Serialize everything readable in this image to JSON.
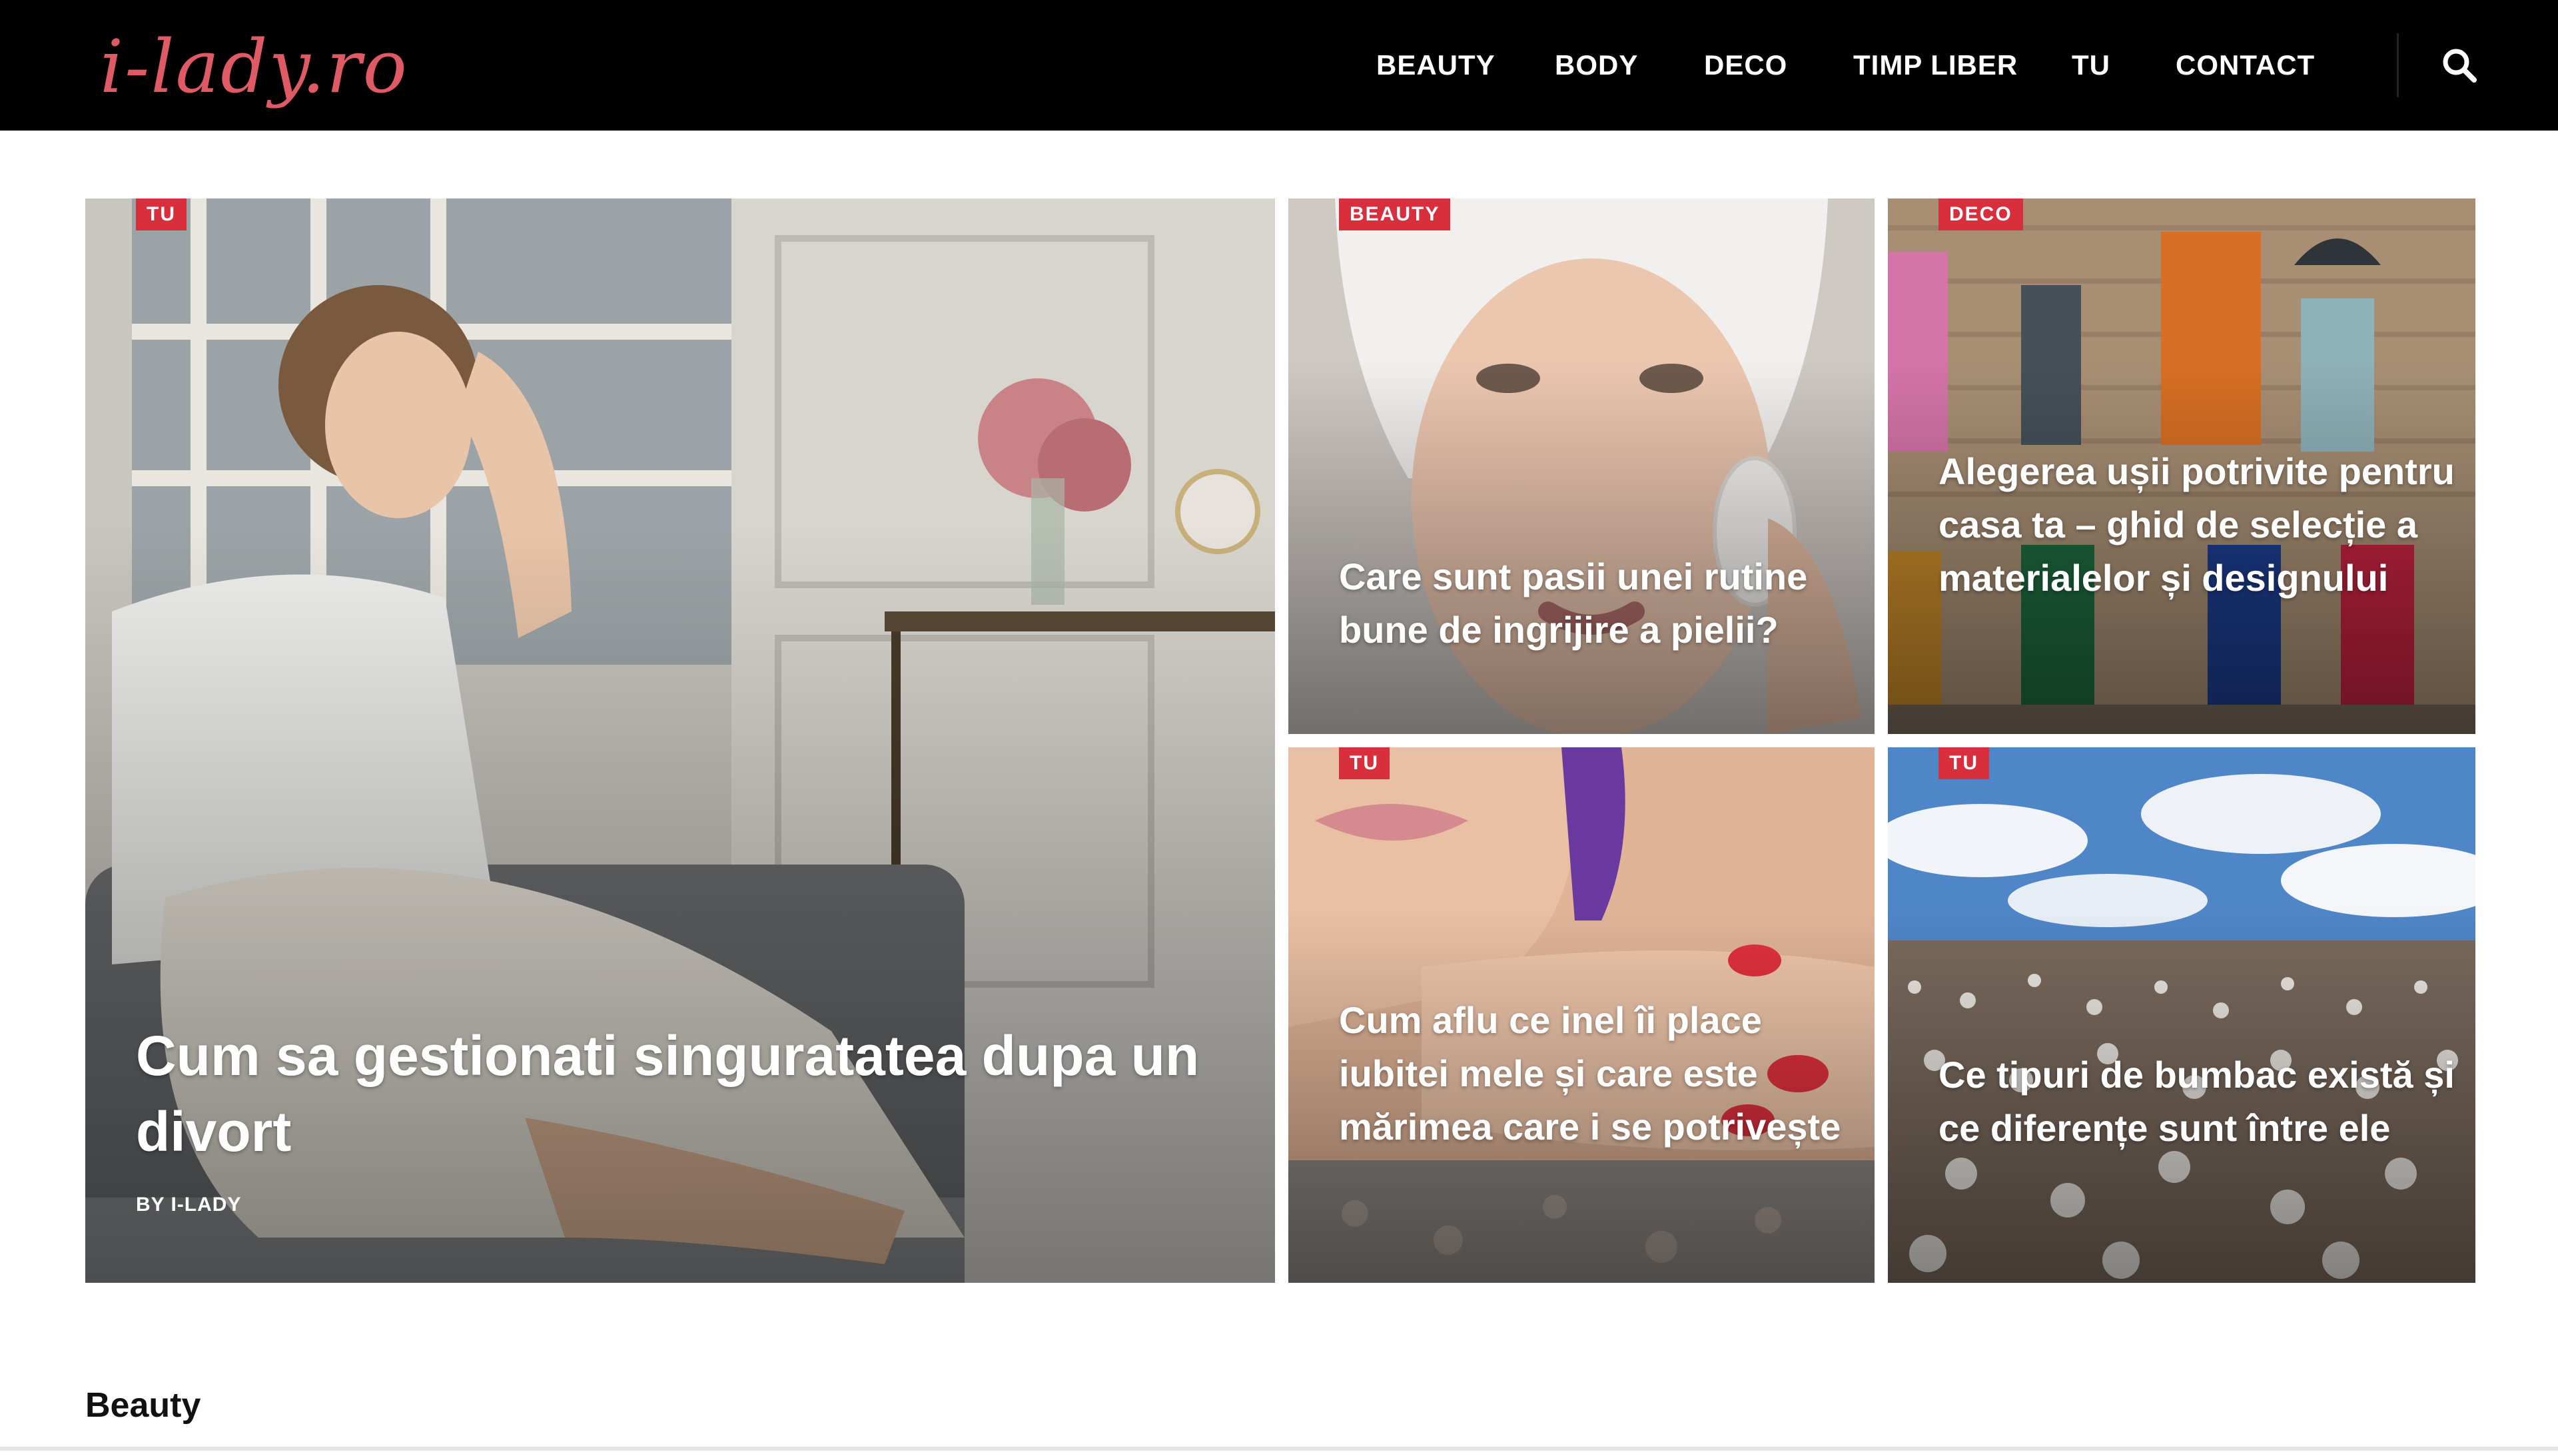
{
  "site": {
    "logo": "i-lady.ro",
    "brand_color": "#e05a66",
    "accent_color": "#d92f3d"
  },
  "nav": {
    "items": [
      {
        "label": "BEAUTY"
      },
      {
        "label": "BODY"
      },
      {
        "label": "DECO"
      },
      {
        "label": "TIMP LIBER"
      },
      {
        "label": "TU"
      },
      {
        "label": "CONTACT"
      }
    ],
    "search_icon": "search-icon"
  },
  "featured": {
    "main": {
      "tag": "TU",
      "title": "Cum sa gestionati singuratatea dupa un divort",
      "byline": "BY I-LADY"
    },
    "top_middle": {
      "tag": "BEAUTY",
      "title": "Care sunt pasii unei rutine bune de ingrijire a pielii?"
    },
    "top_right": {
      "tag": "DECO",
      "title": "Alegerea ușii potrivite pentru casa ta – ghid de selecție a materialelor și designului"
    },
    "bottom_middle": {
      "tag": "TU",
      "title": "Cum aflu ce inel îi place iubitei mele și care este mărimea care i se potrivește"
    },
    "bottom_right": {
      "tag": "TU",
      "title": "Ce tipuri de bumbac există și ce diferențe sunt între ele"
    }
  },
  "section": {
    "title": "Beauty"
  }
}
